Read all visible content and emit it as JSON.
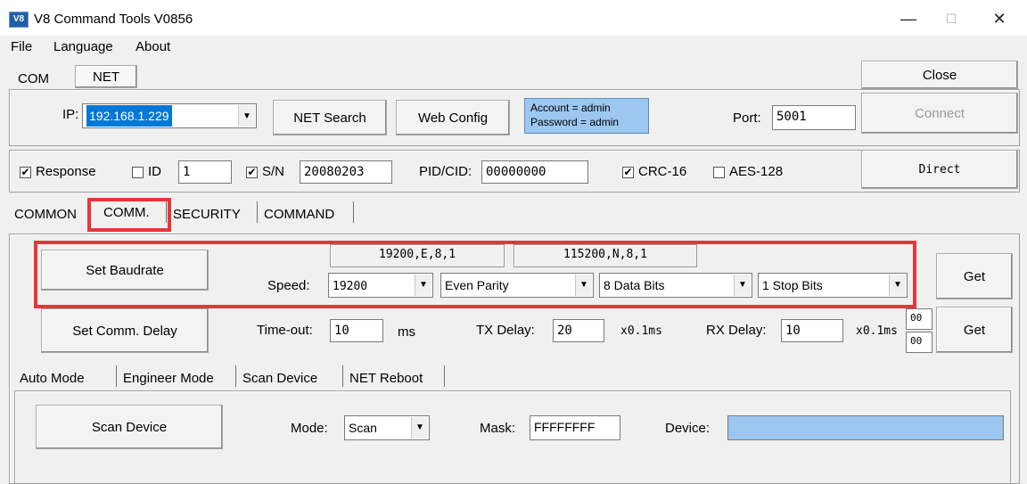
{
  "window": {
    "title": "V8 Command Tools V0856",
    "app_icon": "V8",
    "minimize_glyph": "—",
    "maximize_glyph": "☐",
    "close_glyph": "✕"
  },
  "menu": {
    "file": "File",
    "language": "Language",
    "about": "About"
  },
  "mode_tabs": {
    "com": "COM",
    "net": "NET"
  },
  "close_button": "Close",
  "network": {
    "ip_label": "IP:",
    "ip_value": "192.168.1.229",
    "net_search": "NET Search",
    "web_config": "Web Config",
    "account_line": "Account = admin",
    "password_line": "Password = admin",
    "port_label": "Port:",
    "port_value": "5001",
    "connect": "Connect"
  },
  "options": {
    "response_label": "Response",
    "response_checked": true,
    "id_label": "ID",
    "id_checked": false,
    "id_value": "1",
    "sn_label": "S/N",
    "sn_checked": true,
    "sn_value": "20080203",
    "pid_label": "PID/CID:",
    "pid_value": "00000000",
    "crc_label": "CRC-16",
    "crc_checked": true,
    "aes_label": "AES-128",
    "aes_checked": false,
    "direct": "Direct"
  },
  "main_tabs": [
    "COMMON",
    "COMM.",
    "SECURITY",
    "COMMAND"
  ],
  "comm": {
    "set_baudrate": "Set Baudrate",
    "current_setting": "19200,E,8,1",
    "alt_setting": "115200,N,8,1",
    "speed_label": "Speed:",
    "speed_value": "19200",
    "parity_value": "Even Parity",
    "data_bits_value": "8 Data Bits",
    "stop_bits_value": "1 Stop Bits",
    "get": "Get",
    "set_comm_delay": "Set Comm. Delay",
    "timeout_label": "Time-out:",
    "timeout_value": "10",
    "timeout_unit": "ms",
    "tx_delay_label": "TX Delay:",
    "tx_delay_value": "20",
    "tx_unit": "x0.1ms",
    "rx_delay_label": "RX Delay:",
    "rx_delay_value": "10",
    "rx_unit": "x0.1ms",
    "delay_top": "00",
    "delay_bottom": "00"
  },
  "sub_tabs": [
    "Auto Mode",
    "Engineer Mode",
    "Scan Device",
    "NET Reboot"
  ],
  "scan": {
    "scan_device": "Scan Device",
    "mode_label": "Mode:",
    "mode_value": "Scan",
    "mask_label": "Mask:",
    "mask_value": "FFFFFFFF",
    "device_label": "Device:",
    "device_value": ""
  },
  "colors": {
    "highlight": "#e8353b",
    "info_box": "#9cc7f0",
    "ip_selection": "#0078d7"
  }
}
